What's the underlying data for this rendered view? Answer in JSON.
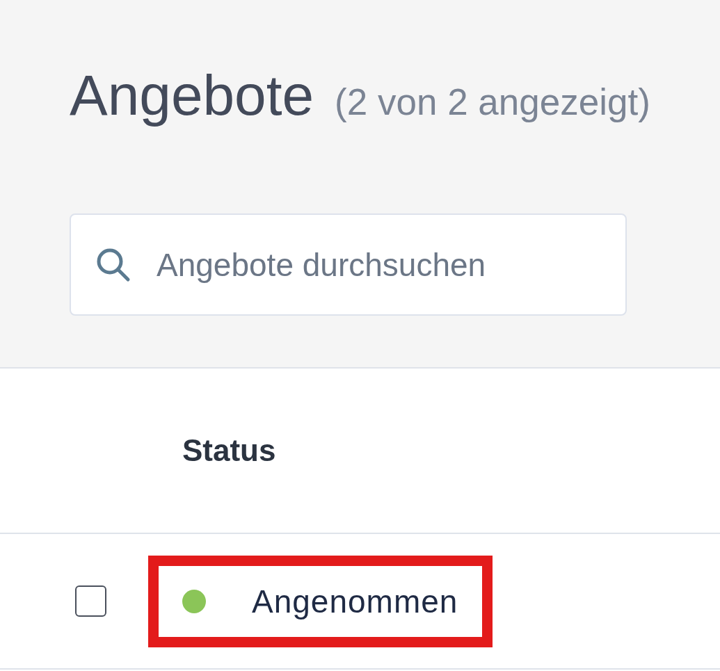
{
  "page": {
    "title": "Angebote",
    "count": "(2 von 2 angezeigt)"
  },
  "search": {
    "placeholder": "Angebote durchsuchen"
  },
  "table": {
    "columns": [
      {
        "label": "Status"
      }
    ],
    "rows": [
      {
        "checked": false,
        "highlighted": true,
        "status": {
          "label": "Angenommen",
          "color": "#8bc558"
        }
      }
    ]
  }
}
